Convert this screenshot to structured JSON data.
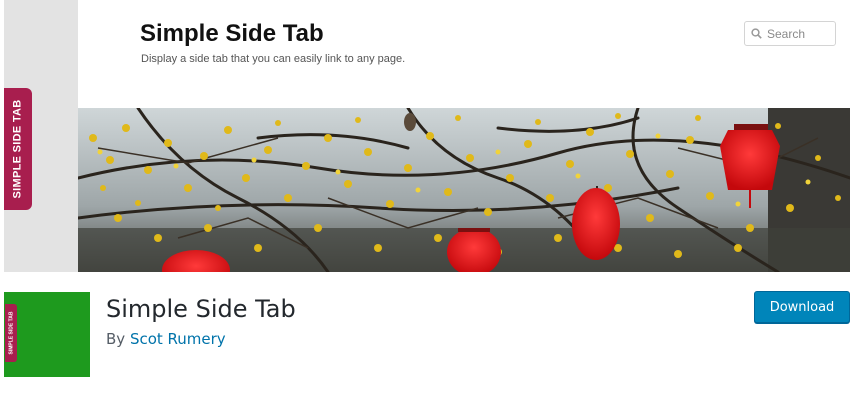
{
  "banner": {
    "side_tab_label": "SIMPLE SIDE TAB",
    "site_title": "Simple Side Tab",
    "tagline": "Display a side tab that you can easily link to any page.",
    "search_placeholder": "Search"
  },
  "plugin": {
    "title": "Simple Side Tab",
    "by_label": "By",
    "author": "Scot Rumery",
    "download_label": "Download",
    "icon_tab_label": "SIMPLE SIDE TAB"
  },
  "colors": {
    "side_tab": "#a81e4e",
    "icon_background": "#1e9a1e",
    "download_button": "#0085ba",
    "author_link": "#0073aa"
  }
}
